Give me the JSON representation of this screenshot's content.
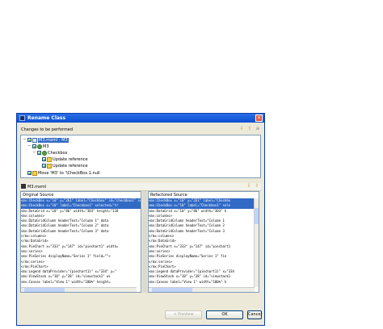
{
  "dialog": {
    "title": "Rename Class",
    "close_glyph": "×"
  },
  "changes": {
    "header": "Changes to be performed",
    "icons": [
      "arrow-down-icon",
      "arrow-up-icon",
      "filter-icon"
    ],
    "items": [
      {
        "label": "M3.mxml - M3",
        "selected": true
      },
      {
        "label": "M3"
      },
      {
        "label": "Checkbox"
      },
      {
        "label": "Update reference"
      },
      {
        "label": "Update reference"
      },
      {
        "label": "Move 'M3' to '\\CheckBox.1.null"
      }
    ]
  },
  "compare": {
    "file_label": "M3.mxml",
    "icons": [
      "arrow-down-icon",
      "arrow-up-icon"
    ],
    "original_title": "Original Source",
    "refactored_title": "Refactored Source",
    "original_lines": [
      "<mx:CheckBox x=\"10\" y=\"261\" label=\"Checkbox\" id=\"checkbox1\" selected=\"t",
      "<mx:CheckBox x=\"10\" label=\"Checkbox1\" selected=\"tr",
      "<mx:DataGrid x=\"10\" y=\"86\" width=\"303\" height=\"118",
      "  <mx:columns>",
      "    <mx:DataGridColumn headerText=\"Column 1\" data",
      "    <mx:DataGridColumn headerText=\"Column 2\" data",
      "    <mx:DataGridColumn headerText=\"Column 3\" data",
      "  </mx:columns>",
      "</mx:DataGrid>",
      "<mx:PieChart x=\"333\" y=\"147\" id=\"piechart1\" width=",
      "  <mx:series>",
      "    <mx:PieSeries displayName=\"Series 1\" field=\"\">",
      "  </mx:series>",
      "</mx:PieChart>",
      "<mx:Legend dataProvider=\"{piechart1}\" x=\"334\" y=\"",
      "<mx:ViewStack x=\"10\" y=\"38\" id=\"viewstack1\" wi",
      "  <mx:Canvas label=\"View 1\" width=\"100%\" height="
    ],
    "refactored_lines": [
      "<mx:CheckBox x=\"10\" y=\"261\" label=\"Checkbo",
      "<mx:CheckBox x=\"10\" label=\"Checkbox1\" sele",
      "<mx:DataGrid x=\"10\" y=\"86\" width=\"303\" h",
      "  <mx:columns>",
      "    <mx:DataGridColumn headerText=\"Column 1",
      "    <mx:DataGridColumn headerText=\"Column 2",
      "    <mx:DataGridColumn headerText=\"Column 3",
      "  </mx:columns>",
      "</mx:DataGrid>",
      "<mx:PieChart x=\"333\" y=\"147\" id=\"piechart1",
      "  <mx:series>",
      "    <mx:PieSeries displayName=\"Series 1\" fie",
      "  </mx:series>",
      "</mx:PieChart>",
      "<mx:Legend dataProvider=\"{piechart1}\" x=\"334",
      "<mx:ViewStack x=\"10\" y=\"38\" id=\"viewstack1",
      "  <mx:Canvas label=\"View 1\" width=\"100%\" h"
    ]
  },
  "buttons": {
    "preview": "< Preview",
    "ok": "OK",
    "cancel": "Cancel"
  },
  "colors": {
    "title_bar": "#0a4fd0",
    "selection": "#316ac5",
    "dialog_bg": "#ece9d8"
  }
}
